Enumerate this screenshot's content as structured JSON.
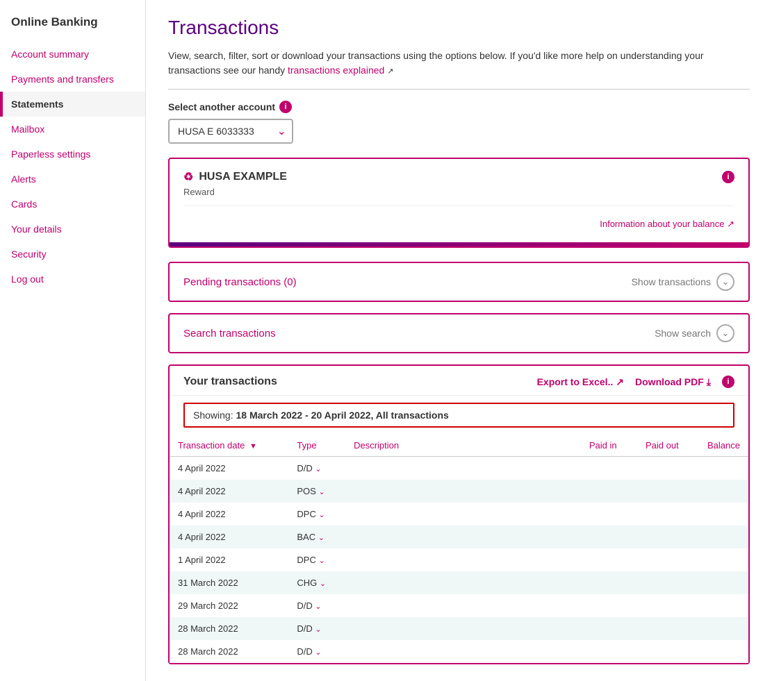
{
  "sidebar": {
    "app_title": "Online Banking",
    "nav_items": [
      {
        "label": "Account summary",
        "id": "account-summary",
        "active": false
      },
      {
        "label": "Payments and transfers",
        "id": "payments-transfers",
        "active": false
      },
      {
        "label": "Statements",
        "id": "statements",
        "active": true
      },
      {
        "label": "Mailbox",
        "id": "mailbox",
        "active": false
      },
      {
        "label": "Paperless settings",
        "id": "paperless-settings",
        "active": false
      },
      {
        "label": "Alerts",
        "id": "alerts",
        "active": false
      },
      {
        "label": "Cards",
        "id": "cards",
        "active": false
      },
      {
        "label": "Your details",
        "id": "your-details",
        "active": false
      },
      {
        "label": "Security",
        "id": "security",
        "active": false
      },
      {
        "label": "Log out",
        "id": "log-out",
        "active": false
      }
    ]
  },
  "main": {
    "page_title": "Transactions",
    "intro_text": "View, search, filter, sort or download your transactions using the options below. If you'd like more help on understanding your transactions see our handy",
    "transactions_explained_link": "transactions explained",
    "select_account_label": "Select another account",
    "account_options": [
      "HUSA E 6033333"
    ],
    "account_selected": "HUSA E 6033333",
    "account_card": {
      "icon": "♻",
      "name": "HUSA EXAMPLE",
      "type": "Reward",
      "balance_link": "Information about your balance"
    },
    "pending_section": {
      "title": "Pending transactions (0)",
      "action_label": "Show transactions"
    },
    "search_section": {
      "title": "Search transactions",
      "action_label": "Show search"
    },
    "transactions_section": {
      "title": "Your transactions",
      "export_label": "Export to Excel..",
      "download_label": "Download PDF",
      "showing_text": "Showing:",
      "showing_detail": "18 March 2022 - 20 April 2022, All transactions",
      "table": {
        "columns": [
          "Transaction date",
          "Type",
          "Description",
          "Paid in",
          "Paid out",
          "Balance"
        ],
        "rows": [
          {
            "date": "4 April 2022",
            "type": "D/D",
            "desc": "",
            "paid_in": "",
            "paid_out": "",
            "balance": ""
          },
          {
            "date": "4 April 2022",
            "type": "POS",
            "desc": "",
            "paid_in": "",
            "paid_out": "",
            "balance": ""
          },
          {
            "date": "4 April 2022",
            "type": "DPC",
            "desc": "",
            "paid_in": "",
            "paid_out": "",
            "balance": ""
          },
          {
            "date": "4 April 2022",
            "type": "BAC",
            "desc": "",
            "paid_in": "",
            "paid_out": "",
            "balance": ""
          },
          {
            "date": "1 April 2022",
            "type": "DPC",
            "desc": "",
            "paid_in": "",
            "paid_out": "",
            "balance": ""
          },
          {
            "date": "31 March 2022",
            "type": "CHG",
            "desc": "",
            "paid_in": "",
            "paid_out": "",
            "balance": ""
          },
          {
            "date": "29 March 2022",
            "type": "D/D",
            "desc": "",
            "paid_in": "",
            "paid_out": "",
            "balance": ""
          },
          {
            "date": "28 March 2022",
            "type": "D/D",
            "desc": "",
            "paid_in": "",
            "paid_out": "",
            "balance": ""
          },
          {
            "date": "28 March 2022",
            "type": "D/D",
            "desc": "",
            "paid_in": "",
            "paid_out": "",
            "balance": ""
          }
        ]
      }
    }
  }
}
